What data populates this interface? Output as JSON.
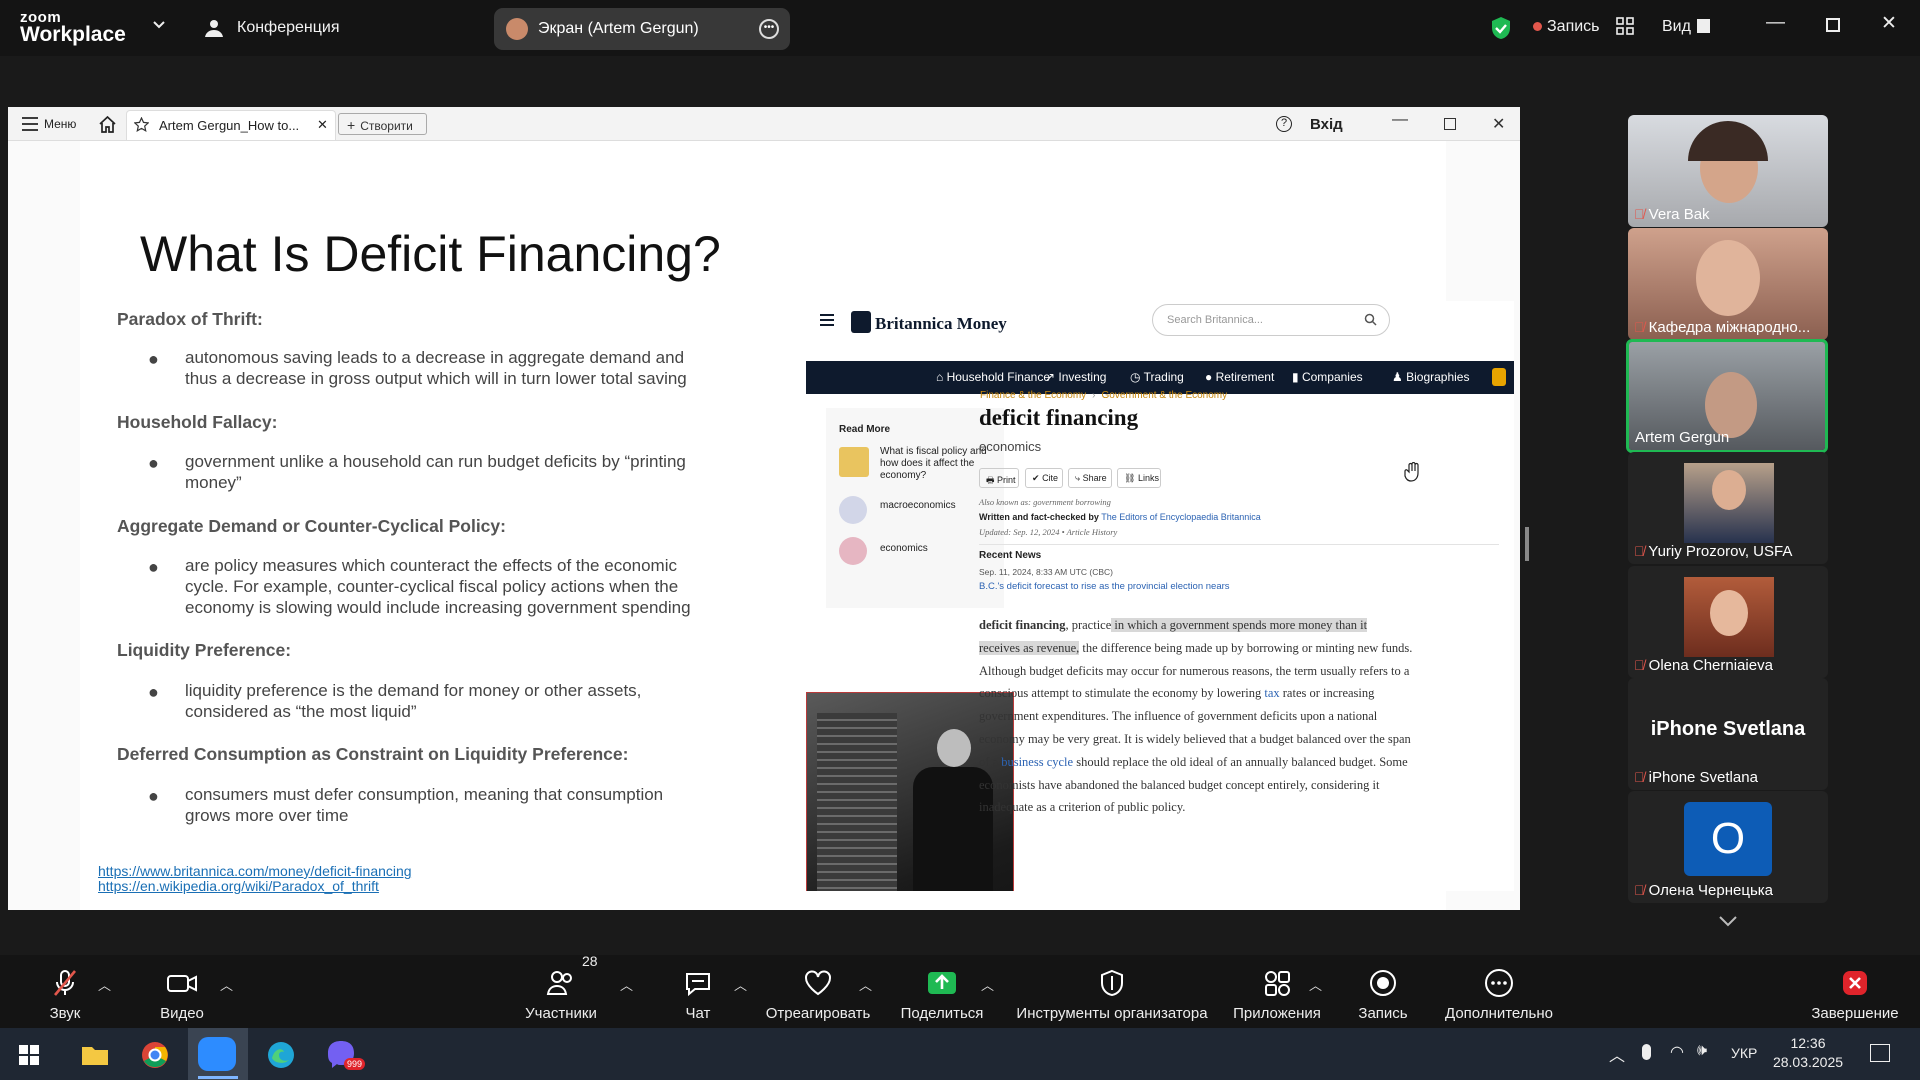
{
  "zoom_bar": {
    "brand_line1": "zoom",
    "brand_line2": "Workplace",
    "meeting_label": "Конференция",
    "share_label": "Экран (Artem Gergun)",
    "record_label": "Запись",
    "view_label": "Вид"
  },
  "ppt": {
    "menu_label": "Меню",
    "tab_title": "Artem Gergun_How to...",
    "create_label": "Створити",
    "signin_label": "Вхід"
  },
  "slide": {
    "title": "What Is Deficit Financing?",
    "sections": [
      {
        "heading": "Paradox of Thrift:",
        "bullet_lines": [
          "autonomous saving leads to a decrease in aggregate demand and",
          "thus a decrease in gross output which will in turn lower total saving"
        ]
      },
      {
        "heading": "Household Fallacy:",
        "bullet_lines": [
          "government unlike a household can run budget deficits by “printing",
          "money”"
        ]
      },
      {
        "heading": "Aggregate Demand or Counter-Cyclical Policy:",
        "bullet_lines": [
          "are policy measures which counteract the effects of the economic",
          "cycle. For example, counter-cyclical fiscal policy actions when the",
          "economy is slowing would include increasing government spending"
        ]
      },
      {
        "heading": "Liquidity Preference:",
        "bullet_lines": [
          "liquidity preference is the demand for money or other assets,",
          "considered as “the most liquid”"
        ]
      },
      {
        "heading": "Deferred Consumption as Constraint on Liquidity Preference:",
        "bullet_lines": [
          "consumers must defer consumption, meaning that consumption",
          "grows more over time"
        ]
      }
    ],
    "links": [
      "https://www.britannica.com/money/deficit-financing",
      "https://en.wikipedia.org/wiki/Paradox_of_thrift"
    ]
  },
  "britannica": {
    "logo": "Britannica Money",
    "search_placeholder": "Search Britannica...",
    "nav": [
      "Household Finance",
      "Investing",
      "Trading",
      "Retirement",
      "Companies",
      "Biographies"
    ],
    "read_more": "Read More",
    "related": [
      "What is fiscal policy and how does it affect the economy?",
      "macroeconomics",
      "economics"
    ],
    "crumb1": "Finance & the Economy",
    "crumb2": "Government & the Economy",
    "article_title": "deficit financing",
    "subject": "economics",
    "actions": [
      "Print",
      "Cite",
      "Share",
      "Links"
    ],
    "also_known": "Also known as: government borrowing",
    "written_by_prefix": "Written and fact-checked by",
    "written_by": "The Editors of Encyclopaedia Britannica",
    "updated": "Updated: Sep. 12, 2024 • Article History",
    "recent_news": "Recent News",
    "news_date": "Sep. 11, 2024, 8:33 AM UTC (CBC)",
    "news_headline": "B.C.'s deficit forecast to rise as the provincial election nears",
    "para": {
      "term": "deficit financing",
      "l1_a": ", practice",
      "l1_hl": " in which a government spends more money than it",
      "l2_hl": "receives as revenue,",
      "l2_b": " the difference being made up by borrowing or minting new funds.",
      "l3": "Although budget deficits may occur for numerous reasons, the term usually refers to a",
      "l4_a": "conscious attempt to stimulate the economy by lowering ",
      "l4_link": "tax",
      "l4_b": " rates or increasing",
      "l5": "government expenditures. The influence of government deficits upon a national",
      "l6": "economy may be very great. It is widely believed that a budget balanced over the span",
      "l7_a": "of a ",
      "l7_link": "business cycle",
      "l7_b": " should replace the old ideal of an annually balanced budget. Some",
      "l8": "economists have abandoned the balanced budget concept entirely, considering it",
      "l9": "inadequate as a criterion of public policy."
    }
  },
  "participants": [
    {
      "name": "Vera Bak"
    },
    {
      "name": "Кафедра міжнародно..."
    },
    {
      "name": "Artem Gergun"
    },
    {
      "name": "Yuriy Prozorov, USFA"
    },
    {
      "name": "Olena Cherniaieva"
    },
    {
      "name": "iPhone Svetlana",
      "big_name": "iPhone Svetlana"
    },
    {
      "name": "Олена Чернецька",
      "initial": "O"
    }
  ],
  "toolbar": {
    "mute": "Звук",
    "video": "Видео",
    "participants": "Участники",
    "participants_count": "28",
    "chat": "Чат",
    "react": "Отреагировать",
    "share": "Поделиться",
    "host_tools": "Инструменты организатора",
    "apps": "Приложения",
    "record": "Запись",
    "more": "Дополнительно",
    "end": "Завершение"
  },
  "taskbar": {
    "lang": "УКР",
    "time": "12:36",
    "date": "28.03.2025",
    "viber_badge": "999"
  },
  "colors": {
    "accent_green": "#1fb953",
    "record_red": "#e2574c",
    "brit_navy": "#0e1a2d",
    "brit_gold": "#c8870b"
  }
}
